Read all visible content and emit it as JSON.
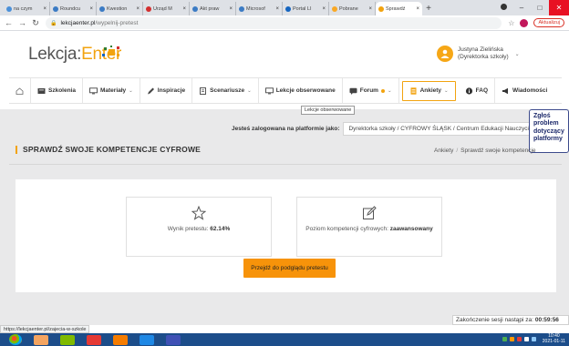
{
  "browser": {
    "tabs": [
      {
        "title": "na czym",
        "color": "#4a90d9"
      },
      {
        "title": "Roundcu",
        "color": "#3b7bc4"
      },
      {
        "title": "Kwestion",
        "color": "#3b7bc4"
      },
      {
        "title": "Urząd M",
        "color": "#d32f2f"
      },
      {
        "title": "Akt praw",
        "color": "#3b7bc4"
      },
      {
        "title": "Microsof",
        "color": "#3b7bc4"
      },
      {
        "title": "Portal LI",
        "color": "#1565c0"
      },
      {
        "title": "Pobrane",
        "color": "#f9a825"
      },
      {
        "title": "Sprawdź",
        "color": "#f2a30f",
        "active": true
      }
    ],
    "url_domain": "lekcjaenter.pl",
    "url_path": "/wypelnij-pretest",
    "update_label": "Aktualizuj"
  },
  "site": {
    "logo_text": "Lekcja:",
    "logo_accent": "Enter",
    "brand_color": "#f2a30f",
    "user_name": "Justyna Zielińska",
    "user_role": "(Dyrektorka szkoły)"
  },
  "nav": {
    "items": [
      {
        "label": "",
        "icon": "home-icon"
      },
      {
        "label": "Szkolenia",
        "icon": "training-icon"
      },
      {
        "label": "Materiały",
        "icon": "monitor-icon",
        "dropdown": true
      },
      {
        "label": "Inspiracje",
        "icon": "pencil-icon"
      },
      {
        "label": "Scenariusze",
        "icon": "document-icon",
        "dropdown": true
      },
      {
        "label": "Lekcje obserwowane",
        "icon": "monitor-icon"
      },
      {
        "label": "Forum",
        "icon": "chat-icon",
        "dropdown": true,
        "dot": true
      },
      {
        "label": "Ankiety",
        "icon": "survey-icon",
        "dropdown": true,
        "active": true
      },
      {
        "label": "FAQ",
        "icon": "info-icon"
      },
      {
        "label": "Wiadomości",
        "icon": "megaphone-icon"
      }
    ],
    "tooltip": "Lekcje obserwowane"
  },
  "platform": {
    "prefix": "Jesteś zalogowana na platformie jako:",
    "value": "Dyrektorka szkoły / CYFROWY ŚLĄSK / Centrum Edukacji Nauczycieli"
  },
  "report_button": "Zgłoś problem dotyczący platformy",
  "page": {
    "title": "SPRAWDŹ SWOJE KOMPETENCJE CYFROWE",
    "breadcrumb": [
      "Ankiety",
      "Sprawdź swoje kompetencje"
    ]
  },
  "results": {
    "score_label": "Wynik pretestu:",
    "score_value": "62.14%",
    "level_label": "Poziom kompetencji cyfrowych:",
    "level_value": "zaawansowany",
    "cta_label": "Przejdź do podglądu pretestu"
  },
  "status_url": "https://lekcjaenter.pl/zajecia-w-szkole",
  "session": {
    "label": "Zakończenie sesji nastąpi za:",
    "time": "00:59:56"
  },
  "taskbar": {
    "time": "10:40",
    "date": "2021-01-11",
    "apps": [
      "#f4a460",
      "#7fba00",
      "#e53935",
      "#f57c00",
      "#1e88e5",
      "#3f51b5"
    ]
  }
}
